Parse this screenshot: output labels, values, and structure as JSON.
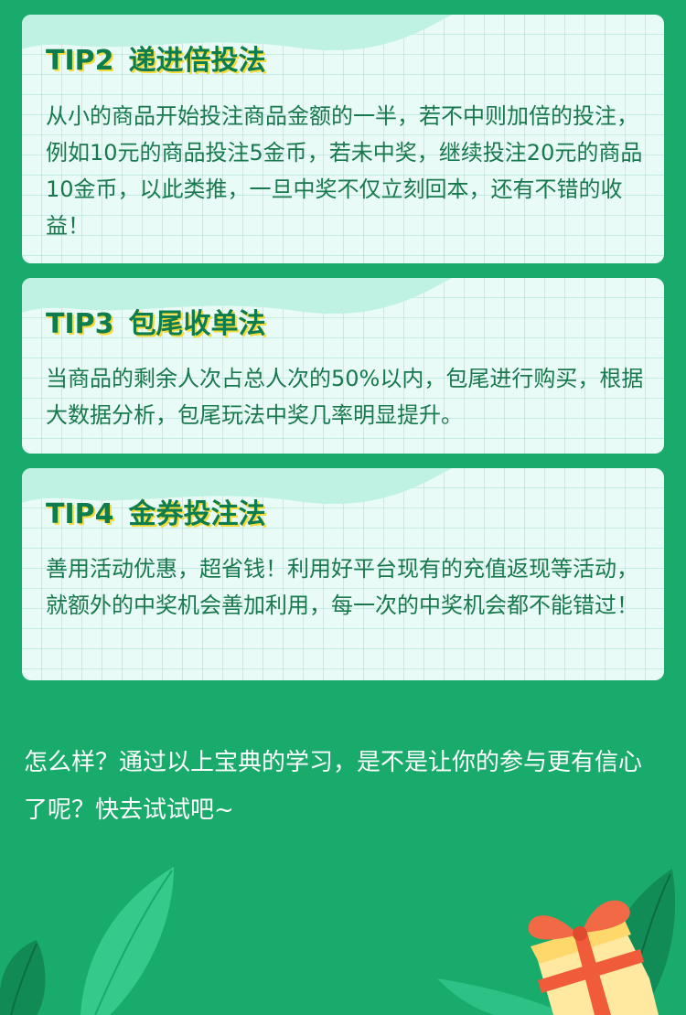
{
  "tips": [
    {
      "label": "TIP2",
      "title": "递进倍投法",
      "body": "从小的商品开始投注商品金额的一半，若不中则加倍的投注，例如10元的商品投注5金币，若未中奖，继续投注20元的商品10金币，以此类推，一旦中奖不仅立刻回本，还有不错的收益！"
    },
    {
      "label": "TIP3",
      "title": "包尾收单法",
      "body": "当商品的剩余人次占总人次的50%以内，包尾进行购买，根据大数据分析，包尾玩法中奖几率明显提升。"
    },
    {
      "label": "TIP4",
      "title": "金券投注法",
      "body": "善用活动优惠，超省钱！利用好平台现有的充值返现等活动，就额外的中奖机会善加利用，每一次的中奖机会都不能错过！"
    }
  ],
  "outro": {
    "text": "怎么样？通过以上宝典的学习，是不是让你的参与更有信心了呢？快去试试吧~"
  },
  "colors": {
    "page_background": "#19ab6b",
    "card_background": "#e9fbf6",
    "title_text": "#0e7d4d",
    "title_shadow": "#f5dc3c",
    "body_text": "#18784e"
  }
}
